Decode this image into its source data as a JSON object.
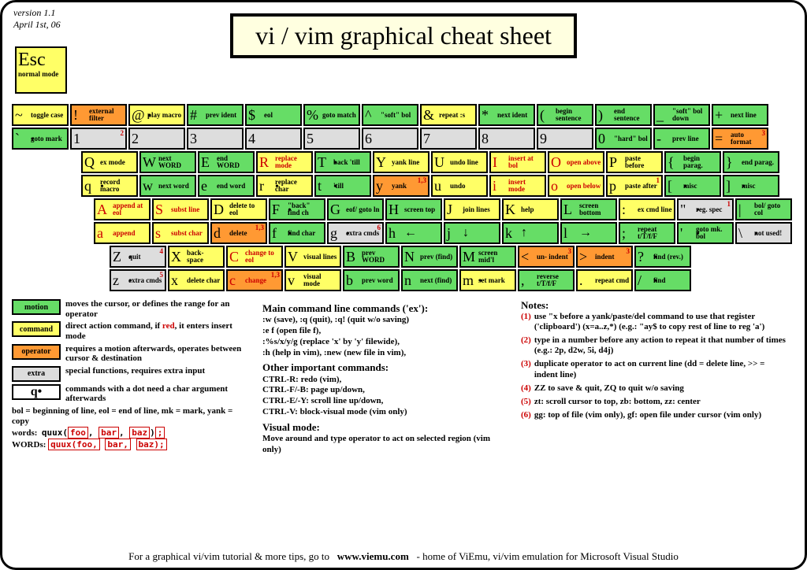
{
  "version": "version 1.1",
  "date": "April 1st, 06",
  "title": "vi / vim graphical cheat sheet",
  "esc": {
    "key": "Esc",
    "desc": "normal mode"
  },
  "rows": [
    [
      {
        "p": [
          {
            "ch": "~",
            "lbl": "toggle case",
            "cls": "command"
          },
          {
            "ch": "`",
            "lbl": "goto mark",
            "cls": "motion dot"
          }
        ]
      },
      {
        "p": [
          {
            "ch": "!",
            "lbl": "external filter",
            "cls": "operator"
          },
          {
            "ch": "1",
            "lbl": "",
            "cls": "extra",
            "sup": "2"
          }
        ]
      },
      {
        "p": [
          {
            "ch": "@",
            "lbl": "play macro",
            "cls": "command dot"
          },
          {
            "ch": "2",
            "lbl": "",
            "cls": "extra"
          }
        ]
      },
      {
        "p": [
          {
            "ch": "#",
            "lbl": "prev ident",
            "cls": "motion"
          },
          {
            "ch": "3",
            "lbl": "",
            "cls": "extra"
          }
        ]
      },
      {
        "p": [
          {
            "ch": "$",
            "lbl": "eol",
            "cls": "motion"
          },
          {
            "ch": "4",
            "lbl": "",
            "cls": "extra"
          }
        ]
      },
      {
        "p": [
          {
            "ch": "%",
            "lbl": "goto match",
            "cls": "motion"
          },
          {
            "ch": "5",
            "lbl": "",
            "cls": "extra"
          }
        ]
      },
      {
        "p": [
          {
            "ch": "^",
            "lbl": "\"soft\" bol",
            "cls": "motion"
          },
          {
            "ch": "6",
            "lbl": "",
            "cls": "extra"
          }
        ]
      },
      {
        "p": [
          {
            "ch": "&",
            "lbl": "repeat :s",
            "cls": "command"
          },
          {
            "ch": "7",
            "lbl": "",
            "cls": "extra"
          }
        ]
      },
      {
        "p": [
          {
            "ch": "*",
            "lbl": "next ident",
            "cls": "motion"
          },
          {
            "ch": "8",
            "lbl": "",
            "cls": "extra"
          }
        ]
      },
      {
        "p": [
          {
            "ch": "(",
            "lbl": "begin sentence",
            "cls": "motion"
          },
          {
            "ch": "9",
            "lbl": "",
            "cls": "extra"
          }
        ]
      },
      {
        "p": [
          {
            "ch": ")",
            "lbl": "end sentence",
            "cls": "motion"
          },
          {
            "ch": "0",
            "lbl": "\"hard\" bol",
            "cls": "motion"
          }
        ]
      },
      {
        "p": [
          {
            "ch": "_",
            "lbl": "\"soft\" bol down",
            "cls": "motion"
          },
          {
            "ch": "-",
            "lbl": "prev line",
            "cls": "motion"
          }
        ]
      },
      {
        "p": [
          {
            "ch": "+",
            "lbl": "next line",
            "cls": "motion"
          },
          {
            "ch": "=",
            "lbl": "auto format",
            "cls": "operator",
            "sup": "3"
          }
        ]
      }
    ],
    [
      {
        "p": [
          {
            "ch": "Q",
            "lbl": "ex mode",
            "cls": "command"
          },
          {
            "ch": "q",
            "lbl": "record macro",
            "cls": "command dot"
          }
        ]
      },
      {
        "p": [
          {
            "ch": "W",
            "lbl": "next WORD",
            "cls": "motion"
          },
          {
            "ch": "w",
            "lbl": "next word",
            "cls": "motion"
          }
        ]
      },
      {
        "p": [
          {
            "ch": "E",
            "lbl": "end WORD",
            "cls": "motion"
          },
          {
            "ch": "e",
            "lbl": "end word",
            "cls": "motion"
          }
        ]
      },
      {
        "p": [
          {
            "ch": "R",
            "lbl": "replace mode",
            "cls": "command red"
          },
          {
            "ch": "r",
            "lbl": "replace char",
            "cls": "command dot"
          }
        ]
      },
      {
        "p": [
          {
            "ch": "T",
            "lbl": "back 'till",
            "cls": "motion dot"
          },
          {
            "ch": "t",
            "lbl": "'till",
            "cls": "motion dot"
          }
        ]
      },
      {
        "p": [
          {
            "ch": "Y",
            "lbl": "yank line",
            "cls": "command"
          },
          {
            "ch": "y",
            "lbl": "yank",
            "cls": "operator",
            "sup": "1,3"
          }
        ]
      },
      {
        "p": [
          {
            "ch": "U",
            "lbl": "undo line",
            "cls": "command"
          },
          {
            "ch": "u",
            "lbl": "undo",
            "cls": "command"
          }
        ]
      },
      {
        "p": [
          {
            "ch": "I",
            "lbl": "insert at bol",
            "cls": "command red"
          },
          {
            "ch": "i",
            "lbl": "insert mode",
            "cls": "command red"
          }
        ]
      },
      {
        "p": [
          {
            "ch": "O",
            "lbl": "open above",
            "cls": "command red"
          },
          {
            "ch": "o",
            "lbl": "open below",
            "cls": "command red"
          }
        ]
      },
      {
        "p": [
          {
            "ch": "P",
            "lbl": "paste before",
            "cls": "command"
          },
          {
            "ch": "p",
            "lbl": "paste after",
            "cls": "command",
            "sup": "1"
          }
        ]
      },
      {
        "p": [
          {
            "ch": "{",
            "lbl": "begin parag.",
            "cls": "motion"
          },
          {
            "ch": "[",
            "lbl": "misc",
            "cls": "motion dot"
          }
        ]
      },
      {
        "p": [
          {
            "ch": "}",
            "lbl": "end parag.",
            "cls": "motion"
          },
          {
            "ch": "]",
            "lbl": "misc",
            "cls": "motion dot"
          }
        ]
      }
    ],
    [
      {
        "p": [
          {
            "ch": "A",
            "lbl": "append at eol",
            "cls": "command red"
          },
          {
            "ch": "a",
            "lbl": "append",
            "cls": "command red"
          }
        ]
      },
      {
        "p": [
          {
            "ch": "S",
            "lbl": "subst line",
            "cls": "command red"
          },
          {
            "ch": "s",
            "lbl": "subst char",
            "cls": "command red"
          }
        ]
      },
      {
        "p": [
          {
            "ch": "D",
            "lbl": "delete to eol",
            "cls": "command"
          },
          {
            "ch": "d",
            "lbl": "delete",
            "cls": "operator",
            "sup": "1,3"
          }
        ]
      },
      {
        "p": [
          {
            "ch": "F",
            "lbl": "\"back\" find ch",
            "cls": "motion dot"
          },
          {
            "ch": "f",
            "lbl": "find char",
            "cls": "motion dot"
          }
        ]
      },
      {
        "p": [
          {
            "ch": "G",
            "lbl": "eof/ goto ln",
            "cls": "motion"
          },
          {
            "ch": "g",
            "lbl": "extra cmds",
            "cls": "extra dot",
            "sup": "6"
          }
        ]
      },
      {
        "p": [
          {
            "ch": "H",
            "lbl": "screen top",
            "cls": "motion"
          },
          {
            "ch": "h",
            "lbl": "←",
            "cls": "motion",
            "arrow": true
          }
        ]
      },
      {
        "p": [
          {
            "ch": "J",
            "lbl": "join lines",
            "cls": "command"
          },
          {
            "ch": "j",
            "lbl": "↓",
            "cls": "motion",
            "arrow": true
          }
        ]
      },
      {
        "p": [
          {
            "ch": "K",
            "lbl": "help",
            "cls": "command"
          },
          {
            "ch": "k",
            "lbl": "↑",
            "cls": "motion",
            "arrow": true
          }
        ]
      },
      {
        "p": [
          {
            "ch": "L",
            "lbl": "screen bottom",
            "cls": "motion"
          },
          {
            "ch": "l",
            "lbl": "→",
            "cls": "motion",
            "arrow": true
          }
        ]
      },
      {
        "p": [
          {
            "ch": ":",
            "lbl": "ex cmd line",
            "cls": "command"
          },
          {
            "ch": ";",
            "lbl": "repeat t/T/f/F",
            "cls": "motion"
          }
        ]
      },
      {
        "p": [
          {
            "ch": "\"",
            "lbl": "reg. spec",
            "cls": "extra dot",
            "sup": "1"
          },
          {
            "ch": "'",
            "lbl": "goto mk. bol",
            "cls": "motion dot"
          }
        ]
      },
      {
        "p": [
          {
            "ch": "|",
            "lbl": "bol/ goto col",
            "cls": "motion"
          },
          {
            "ch": "\\",
            "lbl": "not used!",
            "cls": "extra dot"
          }
        ]
      }
    ],
    [
      {
        "p": [
          {
            "ch": "Z",
            "lbl": "quit",
            "cls": "extra dot",
            "sup": "4"
          },
          {
            "ch": "z",
            "lbl": "extra cmds",
            "cls": "extra dot",
            "sup": "5"
          }
        ]
      },
      {
        "p": [
          {
            "ch": "X",
            "lbl": "back- space",
            "cls": "command"
          },
          {
            "ch": "x",
            "lbl": "delete char",
            "cls": "command"
          }
        ]
      },
      {
        "p": [
          {
            "ch": "C",
            "lbl": "change to eol",
            "cls": "command red"
          },
          {
            "ch": "c",
            "lbl": "change",
            "cls": "operator red",
            "sup": "1,3"
          }
        ]
      },
      {
        "p": [
          {
            "ch": "V",
            "lbl": "visual lines",
            "cls": "command"
          },
          {
            "ch": "v",
            "lbl": "visual mode",
            "cls": "command"
          }
        ]
      },
      {
        "p": [
          {
            "ch": "B",
            "lbl": "prev WORD",
            "cls": "motion"
          },
          {
            "ch": "b",
            "lbl": "prev word",
            "cls": "motion"
          }
        ]
      },
      {
        "p": [
          {
            "ch": "N",
            "lbl": "prev (find)",
            "cls": "motion"
          },
          {
            "ch": "n",
            "lbl": "next (find)",
            "cls": "motion"
          }
        ]
      },
      {
        "p": [
          {
            "ch": "M",
            "lbl": "screen mid'l",
            "cls": "motion"
          },
          {
            "ch": "m",
            "lbl": "set mark",
            "cls": "command dot"
          }
        ]
      },
      {
        "p": [
          {
            "ch": "<",
            "lbl": "un- indent",
            "cls": "operator",
            "sup": "3"
          },
          {
            "ch": ",",
            "lbl": "reverse t/T/f/F",
            "cls": "motion"
          }
        ]
      },
      {
        "p": [
          {
            "ch": ">",
            "lbl": "indent",
            "cls": "operator",
            "sup": "3"
          },
          {
            "ch": ".",
            "lbl": "repeat cmd",
            "cls": "command"
          }
        ]
      },
      {
        "p": [
          {
            "ch": "?",
            "lbl": "find (rev.)",
            "cls": "motion dot"
          },
          {
            "ch": "/",
            "lbl": "find",
            "cls": "motion dot"
          }
        ]
      }
    ]
  ],
  "legend": [
    {
      "cls": "motion",
      "name": "motion",
      "txt": "moves the cursor, or defines the range for an operator"
    },
    {
      "cls": "command",
      "name": "command",
      "txt": "direct action command, if red, it enters insert mode"
    },
    {
      "cls": "operator",
      "name": "operator",
      "txt": "requires a motion afterwards, operates between cursor & destination"
    },
    {
      "cls": "extra",
      "name": "extra",
      "txt": "special functions, requires extra input"
    }
  ],
  "legend_q": "commands with a dot need a char argument afterwards",
  "legend_bol": "bol = beginning of line, eol = end of line, mk = mark, yank = copy",
  "words_label": "words:",
  "WORDS_label": "WORDs:",
  "main_cmds": {
    "h": "Main command line commands ('ex'):",
    "lines": [
      ":w (save), :q (quit), :q! (quit w/o saving)",
      ":e f (open file f),",
      ":%s/x/y/g (replace 'x' by 'y' filewide),",
      ":h (help in vim), :new (new file in vim),"
    ]
  },
  "other_cmds": {
    "h": "Other important commands:",
    "lines": [
      "CTRL-R: redo (vim),",
      "CTRL-F/-B: page up/down,",
      "CTRL-E/-Y: scroll line up/down,",
      "CTRL-V: block-visual mode (vim only)"
    ]
  },
  "visual": {
    "h": "Visual mode:",
    "lines": [
      "Move around and type operator to act on selected region (vim only)"
    ]
  },
  "notes": {
    "h": "Notes:",
    "items": [
      {
        "n": "(1)",
        "t": "use \"x before a yank/paste/del command to use that register ('clipboard') (x=a..z,*) (e.g.: \"ay$ to copy rest of line to reg 'a')"
      },
      {
        "n": "(2)",
        "t": "type in a number before any action to repeat it that number of times (e.g.: 2p, d2w, 5i, d4j)"
      },
      {
        "n": "(3)",
        "t": "duplicate operator to act on current line (dd = delete line, >> = indent line)"
      },
      {
        "n": "(4)",
        "t": "ZZ to save & quit, ZQ to quit w/o saving"
      },
      {
        "n": "(5)",
        "t": "zt: scroll cursor to top, zb: bottom, zz: center"
      },
      {
        "n": "(6)",
        "t": "gg: top of file (vim only), gf: open file under cursor (vim only)"
      }
    ]
  },
  "bottom": "For a graphical vi/vim tutorial & more tips, go to   www.viemu.com   - home of ViEmu, vi/vim emulation for Microsoft Visual Studio"
}
